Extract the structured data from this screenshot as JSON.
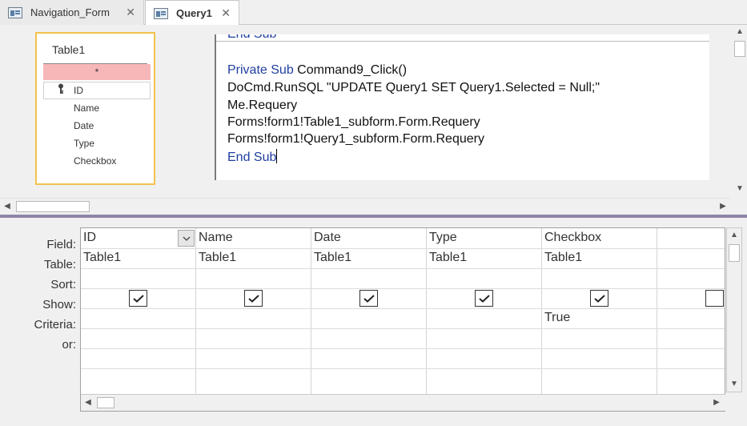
{
  "tabs": [
    {
      "label": "Navigation_Form",
      "icon": "form-icon",
      "active": false
    },
    {
      "label": "Query1",
      "icon": "query-icon",
      "active": true
    }
  ],
  "table_box": {
    "title": "Table1",
    "fields": [
      "*",
      "ID",
      "Name",
      "Date",
      "Type",
      "Checkbox"
    ]
  },
  "code": {
    "top_partial": "End Sub",
    "lines": [
      {
        "kw": "Private Sub",
        "rest": " Command9_Click()"
      },
      {
        "kw": "",
        "rest": "DoCmd.RunSQL \"UPDATE Query1 SET Query1.Selected = Null;\""
      },
      {
        "kw": "",
        "rest": "Me.Requery"
      },
      {
        "kw": "",
        "rest": "Forms!form1!Table1_subform.Form.Requery"
      },
      {
        "kw": "",
        "rest": "Forms!form1!Query1_subform.Form.Requery"
      },
      {
        "kw": "End Sub",
        "rest": ""
      }
    ]
  },
  "grid": {
    "row_labels": [
      "Field:",
      "Table:",
      "Sort:",
      "Show:",
      "Criteria:",
      "or:"
    ],
    "columns": [
      {
        "field": "ID",
        "table": "Table1",
        "sort": "",
        "show": true,
        "criteria": ""
      },
      {
        "field": "Name",
        "table": "Table1",
        "sort": "",
        "show": true,
        "criteria": ""
      },
      {
        "field": "Date",
        "table": "Table1",
        "sort": "",
        "show": true,
        "criteria": ""
      },
      {
        "field": "Type",
        "table": "Table1",
        "sort": "",
        "show": true,
        "criteria": ""
      },
      {
        "field": "Checkbox",
        "table": "Table1",
        "sort": "",
        "show": true,
        "criteria": "True"
      },
      {
        "field": "",
        "table": "",
        "sort": "",
        "show": false,
        "criteria": ""
      }
    ]
  },
  "icons": {
    "close": "close-icon",
    "key": "primary-key-icon",
    "dropdown": "chevron-down-icon"
  },
  "colors": {
    "table_highlight_border": "#f3c24d",
    "star_row_bg": "#f7b7b8",
    "keyword": "#1f3fa0",
    "splitter": "#8f84a8"
  }
}
